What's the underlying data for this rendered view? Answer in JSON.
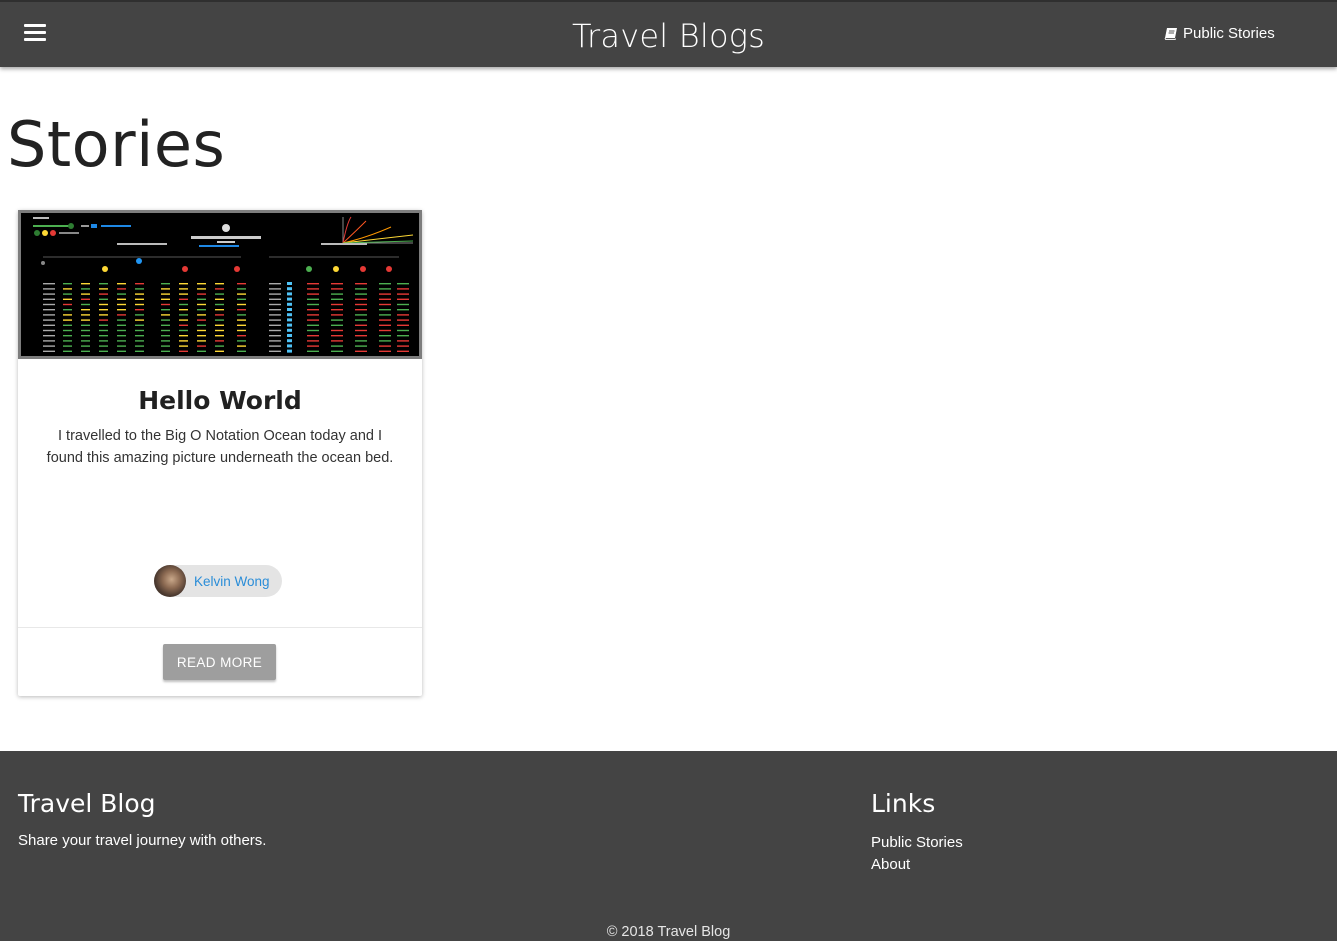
{
  "navbar": {
    "menu_icon": "hamburger-menu-icon",
    "brand": "Travel Blogs",
    "link_icon": "book-icon",
    "link_label": "Public Stories"
  },
  "main": {
    "title": "Stories",
    "cards": [
      {
        "image_alt": "Big-O cheat sheet",
        "title": "Hello World",
        "text": "I travelled to the Big O Notation Ocean today and I found this amazing picture underneath the ocean bed.",
        "author": "Kelvin Wong",
        "button": "Read More"
      }
    ]
  },
  "footer": {
    "left_title": "Travel Blog",
    "left_text": "Share your travel journey with others.",
    "right_title": "Links",
    "links": [
      "Public Stories",
      "About"
    ],
    "copyright": "© 2018 Travel Blog"
  },
  "colors": {
    "navbar_bg": "#444444",
    "footer_bg": "#444444",
    "link_blue": "#2a8dd8",
    "button_grey": "#9e9e9e"
  }
}
